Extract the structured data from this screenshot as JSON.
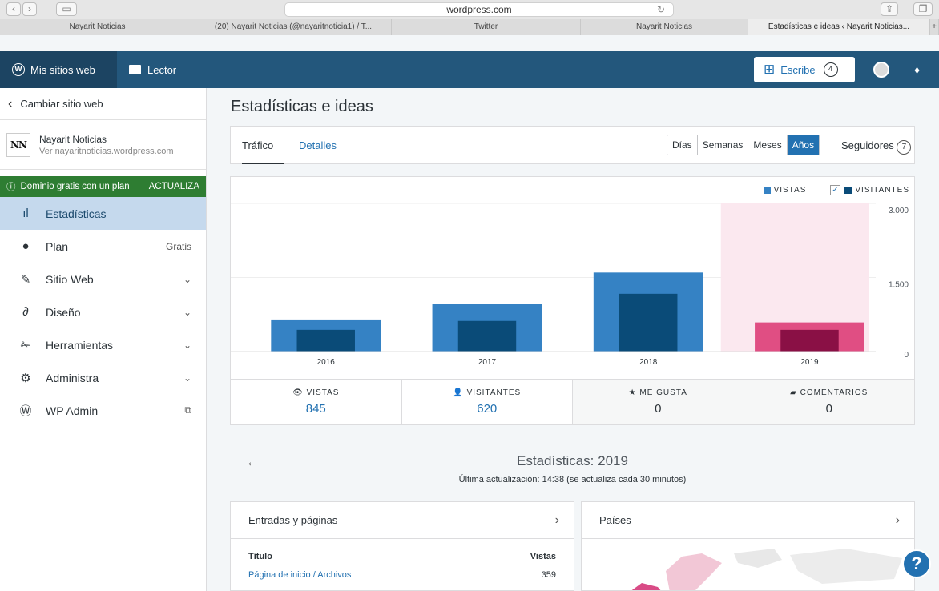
{
  "browser": {
    "url": "wordpress.com",
    "reload": "↻",
    "tabs": [
      "Nayarit Noticias",
      "(20) Nayarit Noticias (@nayaritnoticia1) / T...",
      "Twitter",
      "Nayarit Noticias",
      "Estadísticas e ideas ‹ Nayarit Noticias...",
      "+"
    ]
  },
  "masterbar": {
    "mysites": "Mis sitios web",
    "reader": "Lector",
    "write": "Escribe",
    "write_count": "4"
  },
  "sidebar": {
    "back": "Cambiar sitio web",
    "site_logo": "NN",
    "site_name": "Nayarit Noticias",
    "site_url": "Ver nayaritnoticias.wordpress.com",
    "upsell": "Dominio gratis con un plan",
    "upsell_cta": "ACTUALIZA",
    "items": [
      {
        "label": "Estadísticas",
        "icon": "stats-icon"
      },
      {
        "label": "Plan",
        "icon": "plan-icon",
        "right": "Gratis"
      },
      {
        "label": "Sitio Web",
        "icon": "pencil-icon",
        "right": "⌄"
      },
      {
        "label": "Diseño",
        "icon": "brush-icon",
        "right": "⌄"
      },
      {
        "label": "Herramientas",
        "icon": "wrench-icon",
        "right": "⌄"
      },
      {
        "label": "Administra",
        "icon": "gear-icon",
        "right": "⌄"
      },
      {
        "label": "WP Admin",
        "icon": "wordpress-icon",
        "right": "⧉"
      }
    ]
  },
  "main": {
    "title": "Estadísticas e ideas",
    "tabs": [
      "Tráfico",
      "Detalles"
    ],
    "periods": [
      "Días",
      "Semanas",
      "Meses",
      "Años"
    ],
    "followers": "Seguidores",
    "followers_count": "7"
  },
  "chart_data": {
    "type": "bar",
    "categories": [
      "2016",
      "2017",
      "2018",
      "2019"
    ],
    "series": [
      {
        "name": "VISTAS",
        "values": [
          650,
          960,
          1600,
          590
        ]
      },
      {
        "name": "VISITANTES",
        "values": [
          440,
          620,
          1170,
          440
        ]
      }
    ],
    "yticks": [
      "3.000",
      "1.500",
      "0"
    ],
    "ylim": [
      0,
      3000
    ],
    "highlight": "2019",
    "colors": {
      "views": "#3582c4",
      "visitors": "#0a4b78",
      "views_hl": "#e04e83",
      "visitors_hl": "#8a1045",
      "hl_bg": "#fbe8ef"
    }
  },
  "stats": [
    {
      "label": "VISTAS",
      "value": "845"
    },
    {
      "label": "VISITANTES",
      "value": "620"
    },
    {
      "label": "ME GUSTA",
      "value": "0"
    },
    {
      "label": "COMENTARIOS",
      "value": "0"
    }
  ],
  "summary": {
    "title": "Estadísticas: 2019",
    "subtitle": "Última actualización: 14:38 (se actualiza cada 30 minutos)"
  },
  "posts": {
    "title": "Entradas y páginas",
    "col1": "Título",
    "col2": "Vistas",
    "rows": [
      {
        "title": "Página de inicio / Archivos",
        "views": "359"
      }
    ]
  },
  "countries": {
    "title": "Países"
  }
}
